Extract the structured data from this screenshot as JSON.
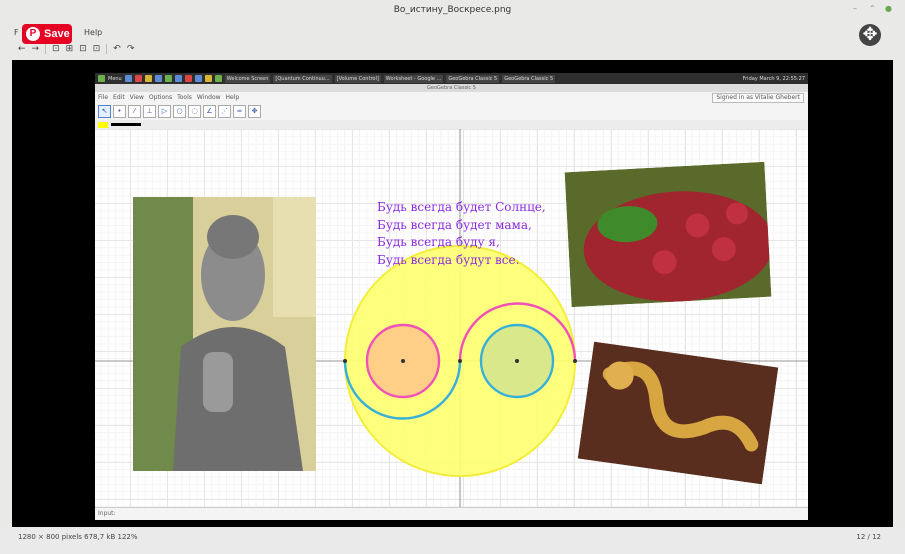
{
  "viewer": {
    "title": "Во_истину_Воскресе.png",
    "menu_left_char": "F",
    "menu_help": "Help",
    "save_label": "Save",
    "toolbar": {
      "back": "←",
      "forward": "→",
      "fit": "⊡",
      "zoom_actual": "⊞",
      "zoom_in": "⊡",
      "zoom_out": "⊡",
      "rotate_left": "↶",
      "rotate_right": "↷"
    },
    "status_info": "1280 × 800 pixels  678,7 kB  122%",
    "page_counter": "12 / 12"
  },
  "screenshot": {
    "taskbar_items": [
      "Menu",
      "Welcome Screen",
      "[Quantum Continuu...",
      "[Volume Control]",
      "Worksheet - Google ...",
      "GeoGebra Classic 5",
      "GeoGebra Classic 5"
    ],
    "clock": "Friday March 9, 22:55:27",
    "app_title": "GeoGebra Classic 5",
    "menus": [
      "File",
      "Edit",
      "View",
      "Options",
      "Tools",
      "Window",
      "Help"
    ],
    "signed_in": "Signed in as Vitalie Ghebert",
    "input_label": "Input:",
    "poem": [
      "Будь всегда будет Солнце,",
      "Будь всегда будет мама,",
      "Будь всегда буду я,",
      "Будь всегда будут все."
    ],
    "colors": {
      "poem": "#8b2be0",
      "big_circle": "#ffff66",
      "left_small_fill": "#ffd28a",
      "right_small_fill": "#d9e890",
      "pink_arc": "#f050b8",
      "blue_arc": "#36b0d8",
      "point": "#4455cc"
    },
    "images": [
      "buddha-statue",
      "raspberries-basket",
      "golden-dragon"
    ]
  }
}
